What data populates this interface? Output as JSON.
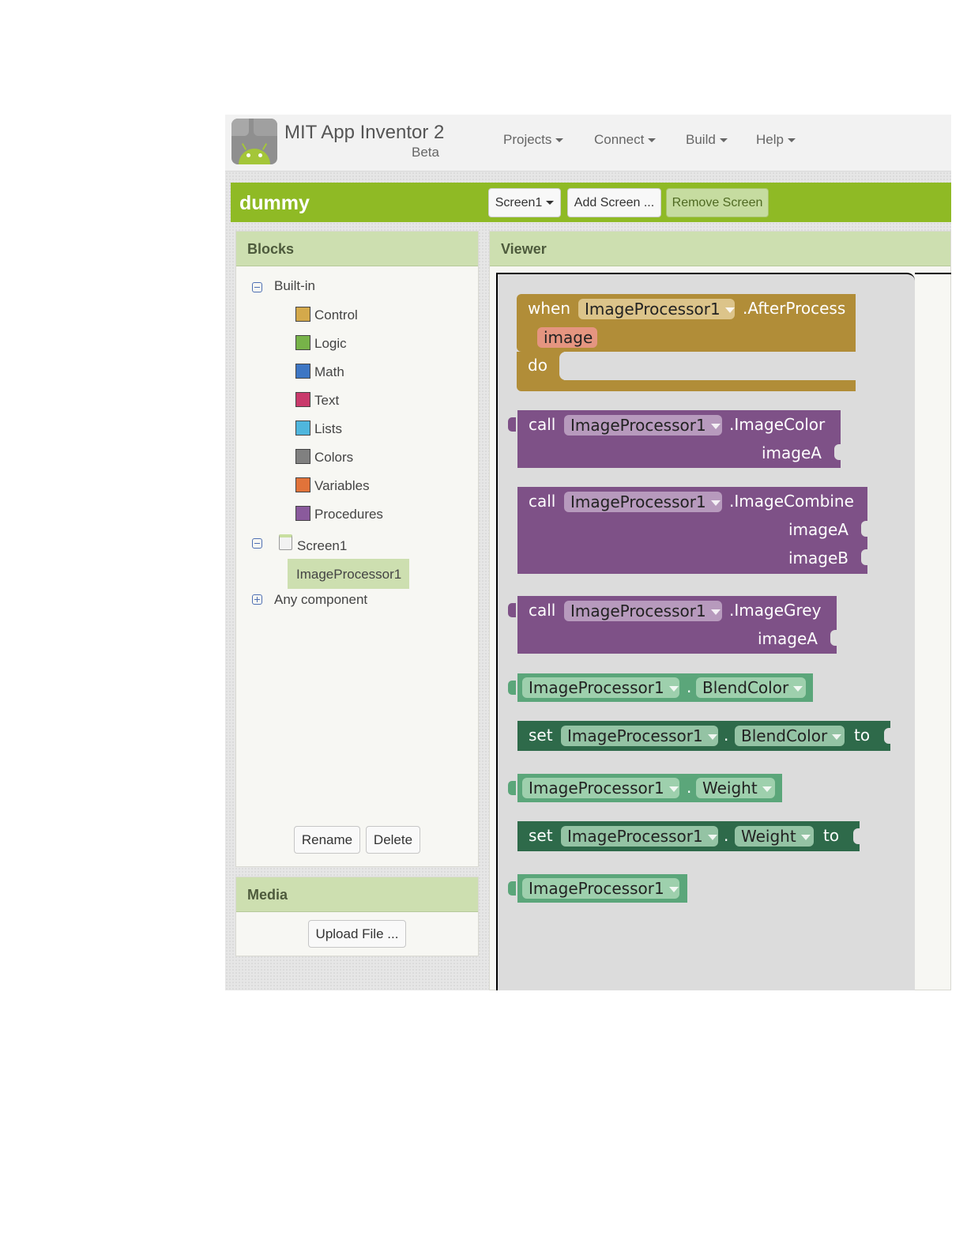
{
  "app": {
    "title": "MIT App Inventor 2",
    "subtitle": "Beta"
  },
  "menu": {
    "projects": "Projects",
    "connect": "Connect",
    "build": "Build",
    "help": "Help"
  },
  "project": {
    "name": "dummy",
    "screen_select": "Screen1",
    "add_screen": "Add Screen ...",
    "remove_screen": "Remove Screen"
  },
  "blocks_panel": {
    "title": "Blocks",
    "builtin_label": "Built-in",
    "builtin": [
      {
        "label": "Control",
        "color": "#d4a94b"
      },
      {
        "label": "Logic",
        "color": "#77b349"
      },
      {
        "label": "Math",
        "color": "#3d76c4"
      },
      {
        "label": "Text",
        "color": "#c93a6b"
      },
      {
        "label": "Lists",
        "color": "#4fb6dd"
      },
      {
        "label": "Colors",
        "color": "#808080"
      },
      {
        "label": "Variables",
        "color": "#e1733a"
      },
      {
        "label": "Procedures",
        "color": "#8a5a9c"
      }
    ],
    "screen_label": "Screen1",
    "component_label": "ImageProcessor1",
    "any_component_label": "Any component",
    "rename_button": "Rename",
    "delete_button": "Delete"
  },
  "media_panel": {
    "title": "Media",
    "upload_button": "Upload File ..."
  },
  "viewer": {
    "title": "Viewer",
    "blocks": {
      "event": {
        "kw": "when",
        "component": "ImageProcessor1",
        "event_name": ".AfterProcess",
        "param": "image",
        "do": "do"
      },
      "image_color": {
        "kw": "call",
        "component": "ImageProcessor1",
        "method": ".ImageColor",
        "arg1": "imageA"
      },
      "image_combine": {
        "kw": "call",
        "component": "ImageProcessor1",
        "method": ".ImageCombine",
        "arg1": "imageA",
        "arg2": "imageB"
      },
      "image_grey": {
        "kw": "call",
        "component": "ImageProcessor1",
        "method": ".ImageGrey",
        "arg1": "imageA"
      },
      "get_blend": {
        "component": "ImageProcessor1",
        "dot": ".",
        "property": "BlendColor"
      },
      "set_blend": {
        "kw": "set",
        "component": "ImageProcessor1",
        "dot": ".",
        "property": "BlendColor",
        "to": "to"
      },
      "get_weight": {
        "component": "ImageProcessor1",
        "dot": ".",
        "property": "Weight"
      },
      "set_weight": {
        "kw": "set",
        "component": "ImageProcessor1",
        "dot": ".",
        "property": "Weight",
        "to": "to"
      },
      "comp_ref": {
        "component": "ImageProcessor1"
      }
    }
  }
}
